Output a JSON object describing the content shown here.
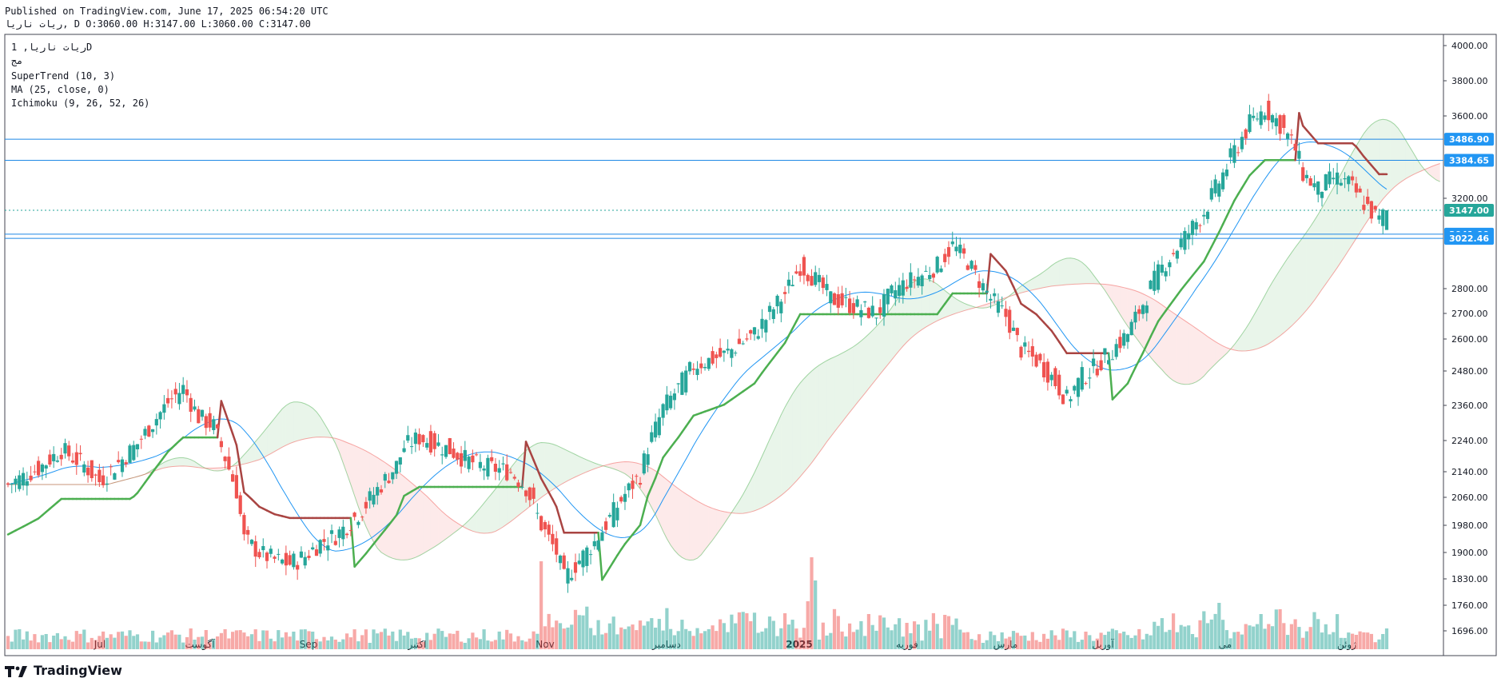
{
  "header": {
    "published": "Published on TradingView.com, June 17, 2025 06:54:20 UTC",
    "symbol_line": "ريات ناريا, D O:3060.00 H:3147.00 L:3060.00 C:3147.00"
  },
  "legend": {
    "symbol": "ريات ناريا, 1D",
    "sub": "مج",
    "supertrend": "SuperTrend (10, 3)",
    "ma": "MA (25, close, 0)",
    "ichimoku": "Ichimoku (9, 26, 52, 26)"
  },
  "branding": {
    "name": "TradingView"
  },
  "colors": {
    "up": "#26a69a",
    "down": "#ef5350",
    "supertrend_up": "#4caf50",
    "supertrend_down": "#a94442",
    "ma": "#2196f3",
    "hline": "#1e88e5"
  },
  "chart_data": {
    "type": "candlestick",
    "price_axis": {
      "scale": "log",
      "ticks": [
        4000,
        3800,
        3600,
        3200,
        2800,
        2700,
        2600,
        2480,
        2360,
        2240,
        2140,
        2060,
        1980,
        1900,
        1830,
        1760,
        1696
      ]
    },
    "price_tick_labels": [
      "4000.00",
      "3800.00",
      "3600.00",
      "3200.00",
      "2800.00",
      "2700.00",
      "2600.00",
      "2480.00",
      "2360.00",
      "2240.00",
      "2140.00",
      "2060.00",
      "1980.00",
      "1900.00",
      "1830.00",
      "1760.00",
      "1696.00"
    ],
    "time_axis": {
      "labels": [
        "Jul",
        "آگوست",
        "Sep",
        "اکتبر",
        "Nov",
        "دسامبر",
        "2025",
        "فوریه",
        "مارس",
        "آوریل",
        "می",
        "ژوئن"
      ]
    },
    "horizontal_lines": [
      {
        "value": 3486.9,
        "label": "3486.90"
      },
      {
        "value": 3384.65,
        "label": "3384.65"
      },
      {
        "value": 3041.0,
        "label": "3041.00"
      },
      {
        "value": 3022.46,
        "label": "3022.46"
      }
    ],
    "last_price": {
      "value": 3147.0,
      "label": "3147.00"
    },
    "series": [
      {
        "name": "SuperTrend (10, 3)",
        "kind": "stepline"
      },
      {
        "name": "MA (25, close, 0)",
        "kind": "line"
      },
      {
        "name": "Ichimoku (9, 26, 52, 26)",
        "kind": "cloud"
      }
    ],
    "close_path": [
      [
        0,
        2100
      ],
      [
        8,
        2150
      ],
      [
        14,
        2210
      ],
      [
        20,
        2160
      ],
      [
        24,
        2110
      ],
      [
        30,
        2180
      ],
      [
        34,
        2230
      ],
      [
        38,
        2300
      ],
      [
        42,
        2370
      ],
      [
        46,
        2420
      ],
      [
        50,
        2320
      ],
      [
        54,
        2290
      ],
      [
        58,
        2150
      ],
      [
        60,
        2080
      ],
      [
        62,
        1940
      ],
      [
        66,
        1900
      ],
      [
        70,
        1880
      ],
      [
        74,
        1870
      ],
      [
        78,
        1890
      ],
      [
        82,
        1930
      ],
      [
        86,
        1950
      ],
      [
        90,
        1990
      ],
      [
        94,
        2040
      ],
      [
        98,
        2100
      ],
      [
        102,
        2160
      ],
      [
        104,
        2220
      ],
      [
        108,
        2250
      ],
      [
        112,
        2230
      ],
      [
        116,
        2210
      ],
      [
        120,
        2180
      ],
      [
        124,
        2160
      ],
      [
        128,
        2150
      ],
      [
        132,
        2140
      ],
      [
        136,
        2090
      ],
      [
        140,
        1980
      ],
      [
        144,
        1900
      ],
      [
        146,
        1830
      ],
      [
        150,
        1880
      ],
      [
        154,
        1930
      ],
      [
        158,
        2000
      ],
      [
        162,
        2070
      ],
      [
        166,
        2130
      ],
      [
        168,
        2220
      ],
      [
        170,
        2280
      ],
      [
        172,
        2350
      ],
      [
        176,
        2420
      ],
      [
        180,
        2500
      ],
      [
        184,
        2520
      ],
      [
        188,
        2540
      ],
      [
        192,
        2580
      ],
      [
        196,
        2620
      ],
      [
        200,
        2700
      ],
      [
        204,
        2780
      ],
      [
        208,
        2900
      ],
      [
        212,
        2840
      ],
      [
        216,
        2760
      ],
      [
        220,
        2740
      ],
      [
        224,
        2720
      ],
      [
        228,
        2700
      ],
      [
        232,
        2780
      ],
      [
        236,
        2830
      ],
      [
        240,
        2860
      ],
      [
        244,
        2900
      ],
      [
        248,
        2990
      ],
      [
        252,
        2920
      ],
      [
        254,
        2860
      ],
      [
        258,
        2760
      ],
      [
        262,
        2690
      ],
      [
        266,
        2560
      ],
      [
        270,
        2520
      ],
      [
        274,
        2460
      ],
      [
        278,
        2380
      ],
      [
        282,
        2460
      ],
      [
        286,
        2500
      ],
      [
        290,
        2560
      ],
      [
        294,
        2620
      ],
      [
        298,
        2740
      ],
      [
        302,
        2870
      ],
      [
        306,
        2960
      ],
      [
        310,
        3050
      ],
      [
        314,
        3140
      ],
      [
        318,
        3280
      ],
      [
        322,
        3430
      ],
      [
        326,
        3560
      ],
      [
        330,
        3640
      ],
      [
        334,
        3560
      ],
      [
        338,
        3440
      ],
      [
        340,
        3320
      ],
      [
        344,
        3240
      ],
      [
        348,
        3300
      ],
      [
        352,
        3270
      ],
      [
        356,
        3180
      ],
      [
        360,
        3100
      ],
      [
        362,
        3147
      ]
    ],
    "notes": "Daily candles from approx. mid-June 2024 to June 2025 with volume histogram"
  }
}
